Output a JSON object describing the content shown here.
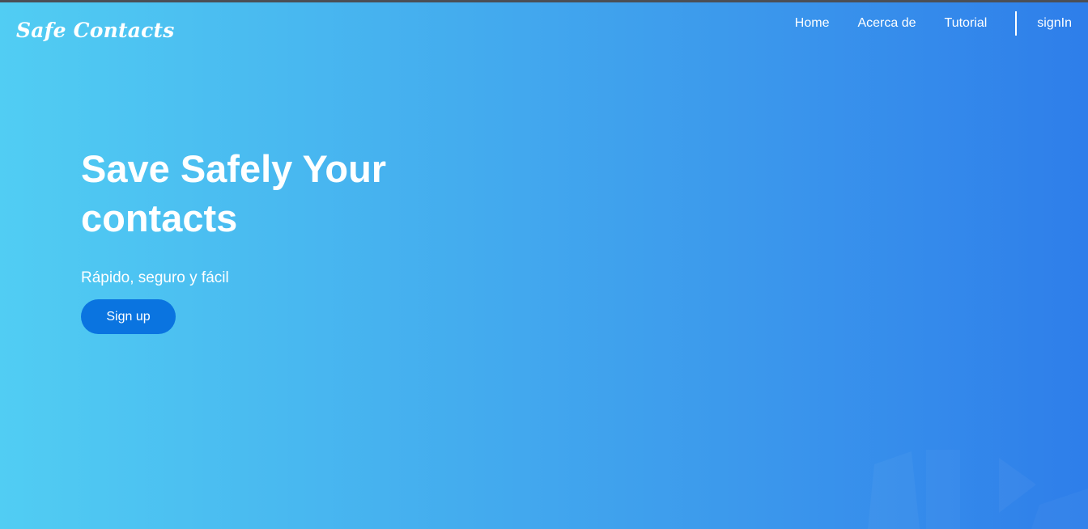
{
  "brand": {
    "name": "Safe Contacts"
  },
  "nav": {
    "items": [
      {
        "label": "Home"
      },
      {
        "label": "Acerca de"
      },
      {
        "label": "Tutorial"
      }
    ],
    "signin_label": "signIn"
  },
  "hero": {
    "title": "Save Safely Your contacts",
    "subtitle": "Rápido, seguro y fácil",
    "cta_label": "Sign up"
  },
  "colors": {
    "gradient_start": "#51cdf3",
    "gradient_end": "#2e7eea",
    "button_bg": "#0a74e0",
    "text": "#ffffff"
  }
}
